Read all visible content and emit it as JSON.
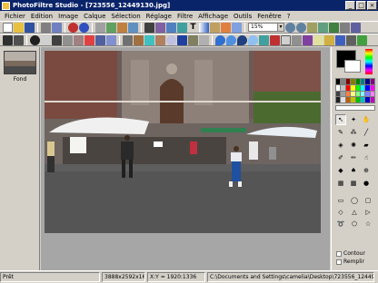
{
  "window": {
    "title": "PhotoFiltre Studio - [723556_12449130.jpg]",
    "minimize": "_",
    "maximize": "□",
    "close": "×"
  },
  "menu": [
    "Fichier",
    "Edition",
    "Image",
    "Calque",
    "Sélection",
    "Réglage",
    "Filtre",
    "Affichage",
    "Outils",
    "Fenêtre",
    "?"
  ],
  "toolbar": {
    "zoom_value": "15%",
    "zoom_arrow": "▾"
  },
  "layers": {
    "fond_label": "Fond"
  },
  "options": {
    "contour_label": "Contour",
    "remplir_label": "Remplir"
  },
  "status": {
    "state": "Prêt",
    "dimensions": "3888x2592x16M",
    "coords": "X:Y = 1920:1336",
    "path": "C:\\Documents and Settings\\camelia\\Desktop\\723556_12449130.jpg"
  },
  "colors": {
    "titlebar": "#0a246a",
    "chrome": "#d4d0c8",
    "workspace": "#a6a6a6",
    "foreground": "#000000",
    "background": "#ffffff"
  },
  "palette": [
    "#000000",
    "#808080",
    "#800000",
    "#808000",
    "#008000",
    "#008080",
    "#000080",
    "#800080",
    "#ffffff",
    "#c0c0c0",
    "#ff0000",
    "#ffff00",
    "#00ff00",
    "#00ffff",
    "#0000ff",
    "#ff00ff",
    "#404040",
    "#a0a0a0",
    "#ff8040",
    "#ffff80",
    "#80ff80",
    "#80ffff",
    "#8080ff",
    "#ff80ff",
    "#202020",
    "#e0e0e0",
    "#c06000",
    "#c0c000",
    "#00c000",
    "#00c0c0",
    "#0000c0",
    "#c000c0"
  ]
}
